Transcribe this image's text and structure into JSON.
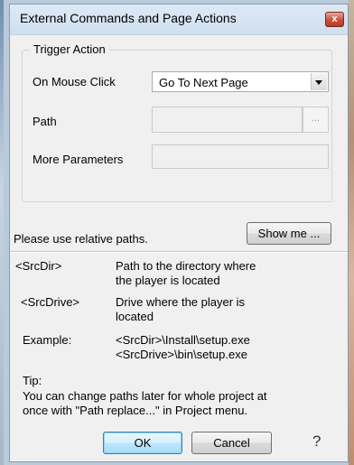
{
  "window": {
    "title": "External Commands and Page Actions",
    "close_glyph": "x"
  },
  "trigger": {
    "group_title": "Trigger Action",
    "on_mouse_click_label": "On Mouse Click",
    "on_mouse_click_value": "Go To Next Page",
    "path_label": "Path",
    "path_value": "",
    "browse_label": "...",
    "more_params_label": "More Parameters",
    "more_params_value": ""
  },
  "relative": {
    "text": "Please use relative paths.",
    "show_me_label": "Show me ..."
  },
  "info": {
    "srcdir_token": "<SrcDir>",
    "srcdir_desc_1": "Path to the directory where",
    "srcdir_desc_2": "the player is located",
    "srcdrive_token": "<SrcDrive>",
    "srcdrive_desc_1": "Drive where the player is",
    "srcdrive_desc_2": "located",
    "example_label": "Example:",
    "example_1": "<SrcDir>\\Install\\setup.exe",
    "example_2": "<SrcDrive>\\bin\\setup.exe",
    "tip_label": "Tip:",
    "tip_1": "You can change paths later for whole project  at",
    "tip_2": "once with \"Path replace...\" in Project menu."
  },
  "buttons": {
    "ok_label": "OK",
    "cancel_label": "Cancel",
    "help_glyph": "?"
  },
  "colors": {
    "dialog_bg": "#f0f0f0",
    "titlebar": "#cfdff0",
    "close": "#c7503d",
    "default_button": "#3c7fb1"
  },
  "icons": {
    "close": "close-icon",
    "dropdown": "chevron-down-icon",
    "help": "help-icon"
  }
}
